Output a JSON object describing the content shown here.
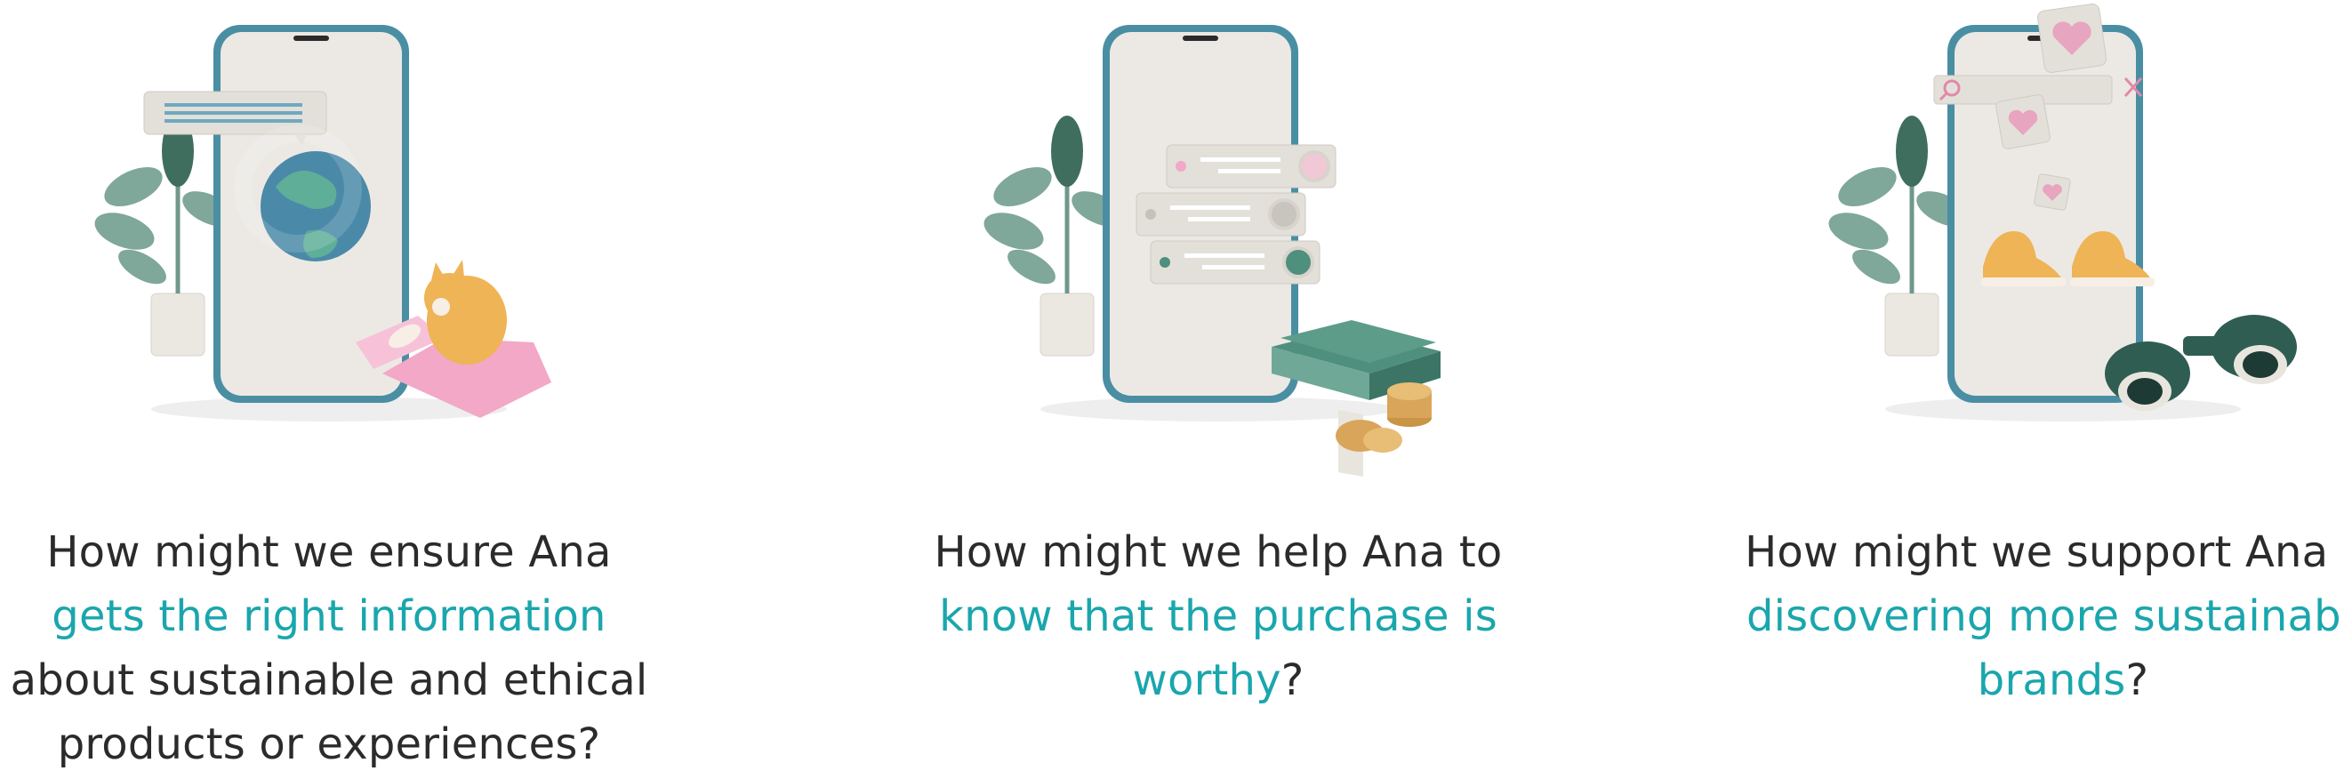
{
  "colors": {
    "text": "#2b2b2b",
    "highlight": "#1aa6ad",
    "phone_frame": "#4a8ea3",
    "phone_screen": "#ece9e4",
    "plant_leaf": "#7fa79a",
    "money": "#4f8f7d",
    "coin": "#d9a55a",
    "heart": "#e8a5bf",
    "box_pink": "#f2a8c6",
    "cat": "#eeb455",
    "binoculars": "#2f5d52"
  },
  "cards": [
    {
      "illustration": [
        "phone-icon",
        "plant-icon",
        "chat-bubble-icon",
        "globe-icon",
        "cat-in-box-icon"
      ],
      "caption": {
        "pre": "How might we ensure Ana ",
        "highlight": "gets the right information",
        "post": " about sustainable and ethical products or experiences?"
      }
    },
    {
      "illustration": [
        "phone-icon",
        "plant-icon",
        "review-cards-icon",
        "money-stack-icon",
        "coins-icon"
      ],
      "caption": {
        "pre": "How might we help Ana to ",
        "highlight": "know that the purchase is worthy",
        "post": "?"
      }
    },
    {
      "illustration": [
        "phone-icon",
        "plant-icon",
        "search-bar-icon",
        "heart-icon",
        "sneakers-icon",
        "binoculars-icon"
      ],
      "caption": {
        "pre": "How might we support Ana in ",
        "highlight": "discovering more sustainable brands",
        "post": "?"
      }
    }
  ]
}
